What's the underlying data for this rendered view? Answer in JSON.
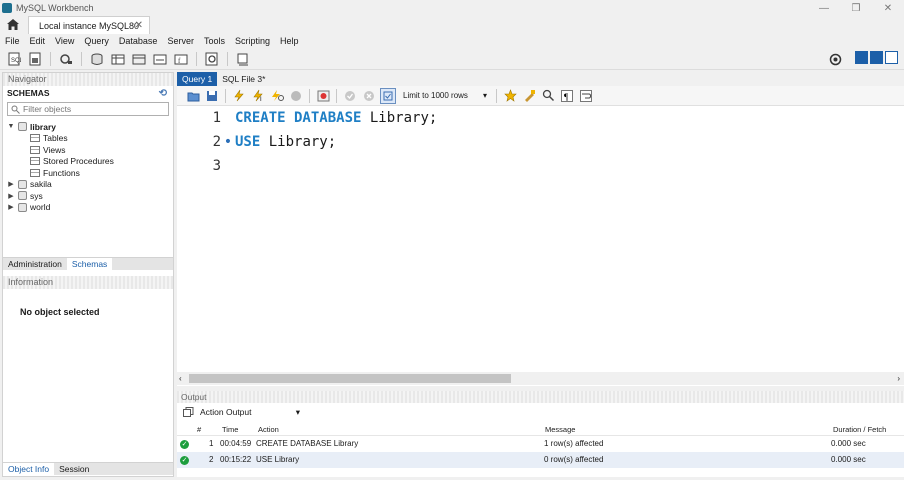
{
  "window": {
    "title": "MySQL Workbench",
    "minimize": "—",
    "restore": "❒",
    "close": "✕"
  },
  "connection_tab": {
    "label": "Local instance MySQL80",
    "close": "✕"
  },
  "menu": [
    "File",
    "Edit",
    "View",
    "Query",
    "Database",
    "Server",
    "Tools",
    "Scripting",
    "Help"
  ],
  "navigator": {
    "title": "Navigator",
    "schemas_title": "SCHEMAS",
    "filter_placeholder": "Filter objects",
    "schemas": [
      {
        "name": "library",
        "expanded": true,
        "children": [
          "Tables",
          "Views",
          "Stored Procedures",
          "Functions"
        ]
      },
      {
        "name": "sakila",
        "expanded": false
      },
      {
        "name": "sys",
        "expanded": false
      },
      {
        "name": "world",
        "expanded": false
      }
    ],
    "tabs": [
      "Administration",
      "Schemas"
    ],
    "active_tab": "Schemas",
    "info_title": "Information",
    "info_text": "No object selected",
    "bottom_tabs": [
      "Object Info",
      "Session"
    ]
  },
  "editor": {
    "tabs": [
      {
        "label": "Query 1",
        "active": true
      },
      {
        "label": "SQL File 3*",
        "active": false
      }
    ],
    "limit_label": "Limit to 1000 rows",
    "lines": [
      {
        "num": "1",
        "marker": "",
        "keyword": "CREATE DATABASE",
        "rest": " Library;"
      },
      {
        "num": "2",
        "marker": "•",
        "keyword": "USE",
        "rest": " Library;"
      },
      {
        "num": "3",
        "marker": "",
        "keyword": "",
        "rest": ""
      }
    ]
  },
  "output": {
    "title": "Output",
    "mode": "Action Output",
    "columns": [
      "#",
      "Time",
      "Action",
      "Message",
      "Duration / Fetch"
    ],
    "rows": [
      {
        "status": "ok",
        "num": "1",
        "time": "00:04:59",
        "action": "CREATE DATABASE Library",
        "message": "1 row(s) affected",
        "duration": "0.000 sec"
      },
      {
        "status": "ok",
        "num": "2",
        "time": "00:15:22",
        "action": "USE Library",
        "message": "0 row(s) affected",
        "duration": "0.000 sec"
      }
    ]
  },
  "colors": {
    "accent": "#1c5fa8",
    "keyword": "#1f7fc5",
    "success": "#1e9e3e"
  }
}
